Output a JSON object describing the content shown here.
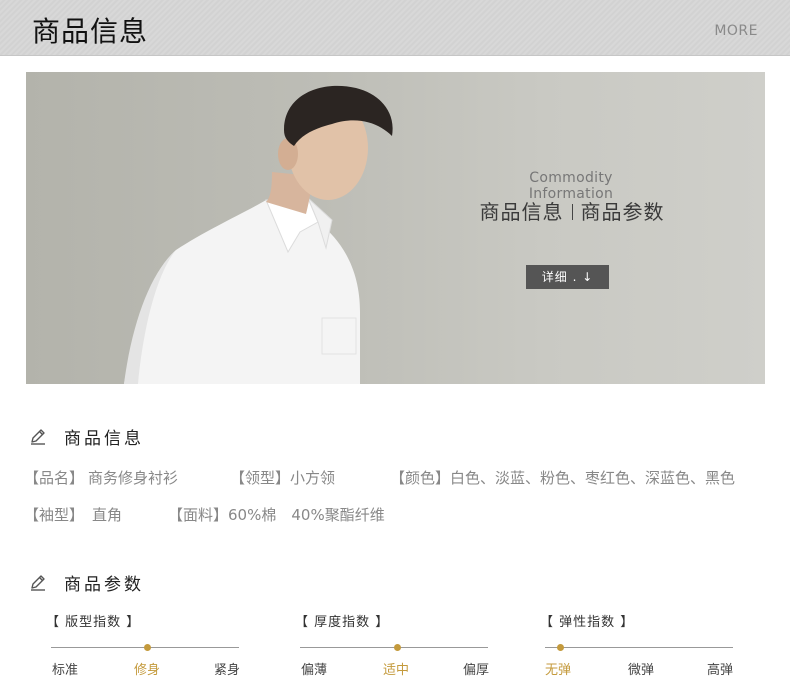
{
  "header": {
    "title": "商品信息",
    "more": "MORE"
  },
  "banner": {
    "en_title": "Commodity Information",
    "cn_left": "商品信息",
    "cn_right": "商品参数",
    "detail_button": "详细 . ↓"
  },
  "info_section": {
    "title": "商品信息",
    "rows": [
      [
        {
          "key": "【品名】",
          "value": "商务修身衬衫"
        },
        {
          "key": "【领型】",
          "value": "小方领"
        },
        {
          "key": "【颜色】",
          "value": "白色、淡蓝、粉色、枣红色、深蓝色、黑色"
        }
      ],
      [
        {
          "key": "【袖型】",
          "value": "直角"
        },
        {
          "key": "【面料】",
          "value": "60%棉　40%聚酯纤维"
        }
      ]
    ]
  },
  "param_section": {
    "title": "商品参数",
    "params": [
      {
        "title": "【 版型指数 】",
        "labels": [
          "标准",
          "修身",
          "紧身"
        ],
        "active": 1
      },
      {
        "title": "【 厚度指数 】",
        "labels": [
          "偏薄",
          "适中",
          "偏厚"
        ],
        "active": 1
      },
      {
        "title": "【 弹性指数 】",
        "labels": [
          "无弹",
          "微弹",
          "高弹"
        ],
        "active": 0
      }
    ]
  },
  "colors": {
    "accent": "#c49a3c",
    "button_bg": "#555555",
    "banner_bg": "#bdbdb6"
  }
}
